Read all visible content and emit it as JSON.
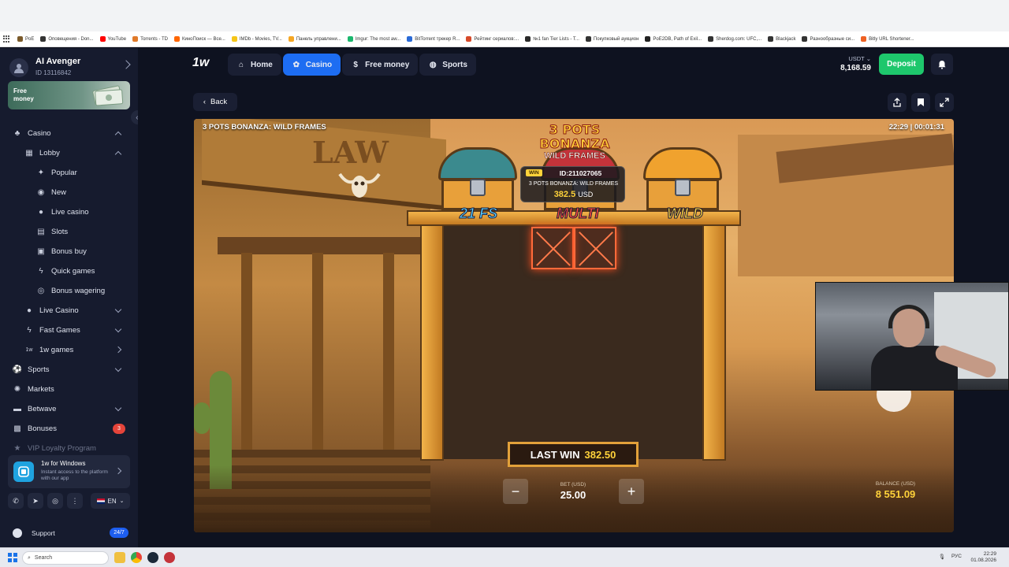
{
  "bookmarks": [
    {
      "label": "PoE",
      "color": "#7a5a2a"
    },
    {
      "label": "Оповещения - Don...",
      "color": "#333333"
    },
    {
      "label": "YouTube",
      "color": "#ff0000"
    },
    {
      "label": "Torrents - TD",
      "color": "#e07a2a"
    },
    {
      "label": "КиноПоиск — Все...",
      "color": "#ff6600"
    },
    {
      "label": "IMDb - Movies, TV...",
      "color": "#f5c518"
    },
    {
      "label": "Панель управлени...",
      "color": "#f5a623"
    },
    {
      "label": "Imgur: The most aw...",
      "color": "#1bb76e"
    },
    {
      "label": "BitTorrent трекер R...",
      "color": "#2a6ad6"
    },
    {
      "label": "Рейтинг сериалов:...",
      "color": "#d64a2a"
    },
    {
      "label": "№1 fan Tier Lists - T...",
      "color": "#2a2a2a"
    },
    {
      "label": "Покупковый аукцион",
      "color": "#333333"
    },
    {
      "label": "PoE2DB, Path of Exil...",
      "color": "#222222"
    },
    {
      "label": "Sherdog.com: UFC,...",
      "color": "#333333"
    },
    {
      "label": "Blackjack",
      "color": "#333333"
    },
    {
      "label": "Разнообразные си...",
      "color": "#333333"
    },
    {
      "label": "Bitly URL Shortener...",
      "color": "#ee6123"
    }
  ],
  "user": {
    "name": "AI Avenger",
    "id": "ID 13116842"
  },
  "free_money": {
    "label": "Free money"
  },
  "nav": [
    {
      "label": "Casino",
      "level": 0,
      "icon": "casino-icon",
      "chevron": "up"
    },
    {
      "label": "Lobby",
      "level": 1,
      "icon": "grid-icon",
      "chevron": "up"
    },
    {
      "label": "Popular",
      "level": 2,
      "icon": "sparkle-icon"
    },
    {
      "label": "New",
      "level": 2,
      "icon": "new-icon"
    },
    {
      "label": "Live casino",
      "level": 2,
      "icon": "live-icon"
    },
    {
      "label": "Slots",
      "level": 2,
      "icon": "slots-icon"
    },
    {
      "label": "Bonus buy",
      "level": 2,
      "icon": "bonus-buy-icon"
    },
    {
      "label": "Quick games",
      "level": 2,
      "icon": "lightning-icon"
    },
    {
      "label": "Bonus wagering",
      "level": 2,
      "icon": "wagering-icon"
    },
    {
      "label": "Live Casino",
      "level": 1,
      "icon": "live-casino-icon",
      "chevron": "down"
    },
    {
      "label": "Fast Games",
      "level": 1,
      "icon": "lightning-icon",
      "chevron": "down"
    },
    {
      "label": "1w games",
      "level": 1,
      "icon": "1w-icon",
      "chevron": "right"
    },
    {
      "label": "Sports",
      "level": 0,
      "icon": "sports-icon",
      "chevron": "down"
    },
    {
      "label": "Markets",
      "level": 0,
      "icon": "markets-icon"
    },
    {
      "label": "Betwave",
      "level": 0,
      "icon": "betwave-icon",
      "chevron": "down"
    },
    {
      "label": "Bonuses",
      "level": 0,
      "icon": "gift-icon",
      "badge": "3"
    },
    {
      "label": "VIP Loyalty Program",
      "level": 0,
      "icon": "vip-icon",
      "faded": true
    }
  ],
  "windows_promo": {
    "title": "1w for Windows",
    "subtitle": "Instant access to the platform with our app"
  },
  "language": "EN",
  "support": {
    "label": "Support",
    "badge": "24/7"
  },
  "header": {
    "logo": "1w",
    "tabs": [
      {
        "label": "Home",
        "icon": "home-icon",
        "active": false
      },
      {
        "label": "Casino",
        "icon": "casino-icon",
        "active": true
      },
      {
        "label": "Free money",
        "icon": "dollar-icon",
        "active": false
      },
      {
        "label": "Sports",
        "icon": "ball-icon",
        "active": false
      }
    ],
    "currency": "USDT",
    "balance": "8,168.59",
    "deposit_label": "Deposit"
  },
  "back_label": "Back",
  "game": {
    "title": "3 POTS BONANZA: WILD FRAMES",
    "time": "22:29 | 00:01:31",
    "logo_line1": "3 POTS BONANZA",
    "logo_line2": "WILD FRAMES",
    "win_tooltip": {
      "tag": "WIN",
      "id": "ID:211027065",
      "game": "3 POTS BONANZA: WILD FRAMES",
      "amount": "382.5",
      "currency": "USD"
    },
    "pot_labels": [
      {
        "text": "21 FS",
        "color": "#5ad0ff"
      },
      {
        "text": "MULTI",
        "color": "#ff4a3a"
      },
      {
        "text": "WILD",
        "color": "#ffd23a"
      }
    ],
    "sign_text": "LAW",
    "last_win_label": "LAST WIN",
    "last_win_value": "382.50",
    "bet_label": "BET (USD)",
    "bet_value": "25.00",
    "balance_label": "BALANCE (USD)",
    "balance_value": "8 551.09",
    "minus": "−",
    "plus": "+"
  },
  "taskbar": {
    "search": "Search",
    "tray_lang": "РУС",
    "time": "22:29",
    "date": "01.08.2026"
  }
}
